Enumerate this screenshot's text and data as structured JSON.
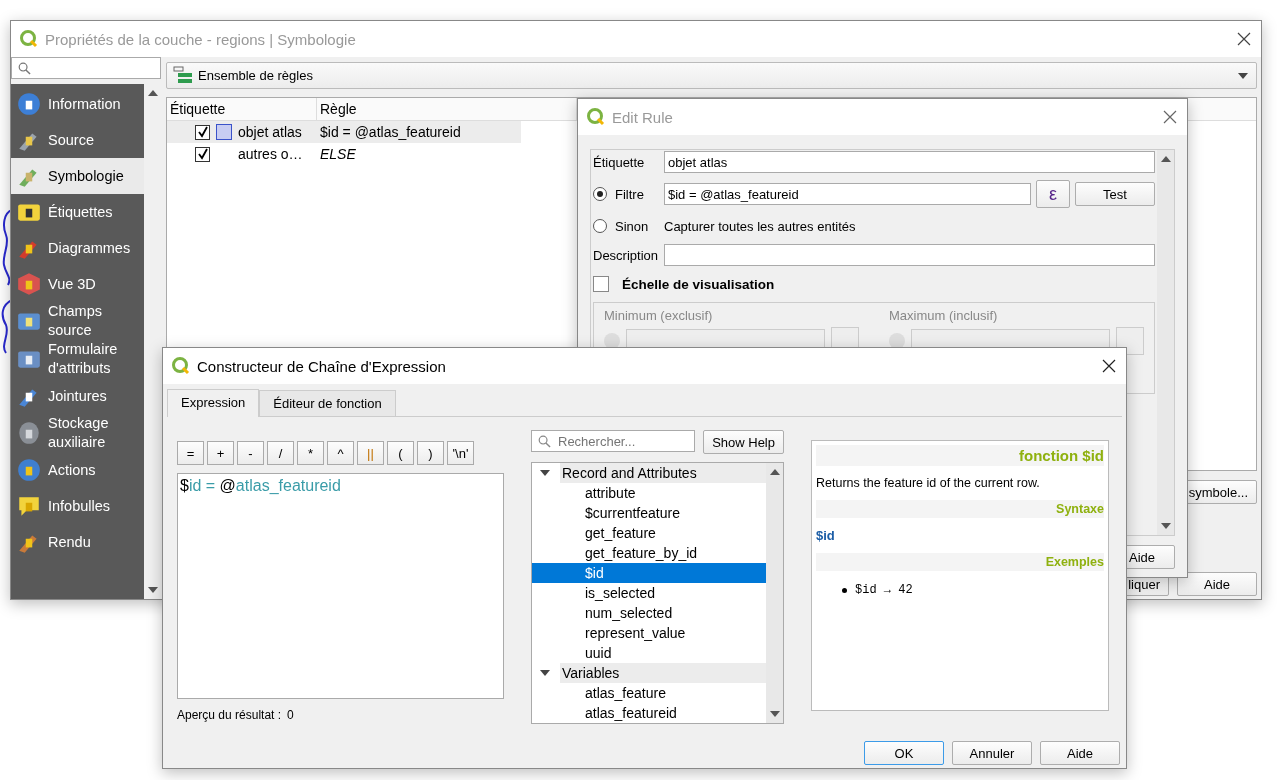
{
  "properties_window": {
    "title": "Propriétés de la couche - regions | Symbologie",
    "sidebar": {
      "items": [
        {
          "label": "Information",
          "selected": false
        },
        {
          "label": "Source",
          "selected": false
        },
        {
          "label": "Symbologie",
          "selected": true
        },
        {
          "label": "Étiquettes",
          "selected": false
        },
        {
          "label": "Diagrammes",
          "selected": false
        },
        {
          "label": "Vue 3D",
          "selected": false
        },
        {
          "label": "Champs source",
          "selected": false
        },
        {
          "label": "Formulaire d'attributs",
          "selected": false
        },
        {
          "label": "Jointures",
          "selected": false
        },
        {
          "label": "Stockage auxiliaire",
          "selected": false
        },
        {
          "label": "Actions",
          "selected": false
        },
        {
          "label": "Infobulles",
          "selected": false
        },
        {
          "label": "Rendu",
          "selected": false
        }
      ]
    },
    "renderer": "Ensemble de règles",
    "table": {
      "columns": [
        "Étiquette",
        "Règle"
      ],
      "rows": [
        {
          "checked": true,
          "color": "#c8cdf2",
          "label": "objet atlas",
          "rule": "$id = @atlas_featureid",
          "kind": "filter",
          "selected": true
        },
        {
          "checked": true,
          "label": "autres o…",
          "rule": "ELSE",
          "kind": "else",
          "selected": false
        }
      ]
    },
    "symbol_button": "symbole...",
    "apply_button": "liquer",
    "help_button": "Aide"
  },
  "edit_rule": {
    "title": "Edit Rule",
    "label_caption": "Étiquette",
    "label_value": "objet atlas",
    "filter": {
      "caption": "Filtre",
      "selected": true,
      "value": "$id = @atlas_featureid",
      "expression_button": "ε",
      "test_button": "Test"
    },
    "else": {
      "caption": "Sinon",
      "selected": false,
      "text": "Capturer toutes les autres entités"
    },
    "description_caption": "Description",
    "scale": {
      "caption": "Échelle de visualisation",
      "checked": false,
      "disabled": true,
      "minimum": "Minimum (exclusif)",
      "maximum": "Maximum (inclusif)"
    },
    "help_button": "Aide"
  },
  "expression_builder": {
    "title": "Constructeur de Chaîne d'Expression",
    "tabs": [
      {
        "label": "Expression",
        "selected": true
      },
      {
        "label": "Éditeur de fonction",
        "selected": false
      }
    ],
    "operators": [
      "=",
      "+",
      "-",
      "/",
      "*",
      "^",
      "||",
      "(",
      ")",
      "'\\n'"
    ],
    "expression": [
      {
        "text": "$",
        "kind": "plain"
      },
      {
        "text": "id = ",
        "kind": "name"
      },
      {
        "text": "@",
        "kind": "plain"
      },
      {
        "text": "atlas_featureid",
        "kind": "name"
      }
    ],
    "preview_label": "Aperçu du résultat :",
    "preview_value": "0",
    "search": {
      "placeholder": "Rechercher..."
    },
    "show_help": "Show Help",
    "tree": [
      {
        "label": "Record and Attributes",
        "expanded": true,
        "children": [
          {
            "label": "attribute",
            "selected": false
          },
          {
            "label": "$currentfeature",
            "selected": false
          },
          {
            "label": "get_feature",
            "selected": false
          },
          {
            "label": "get_feature_by_id",
            "selected": false
          },
          {
            "label": "$id",
            "selected": true
          },
          {
            "label": "is_selected",
            "selected": false
          },
          {
            "label": "num_selected",
            "selected": false
          },
          {
            "label": "represent_value",
            "selected": false
          },
          {
            "label": "uuid",
            "selected": false
          }
        ]
      },
      {
        "label": "Variables",
        "expanded": true,
        "children": [
          {
            "label": "atlas_feature",
            "selected": false
          },
          {
            "label": "atlas_featureid",
            "selected": false
          }
        ]
      }
    ],
    "help": {
      "heading": "fonction $id",
      "description": "Returns the feature id of the current row.",
      "syntax_heading": "Syntaxe",
      "syntax": "$id",
      "examples_heading": "Exemples",
      "examples": [
        "$id → 42"
      ]
    },
    "buttons": [
      "OK",
      "Annuler",
      "Aide"
    ]
  }
}
